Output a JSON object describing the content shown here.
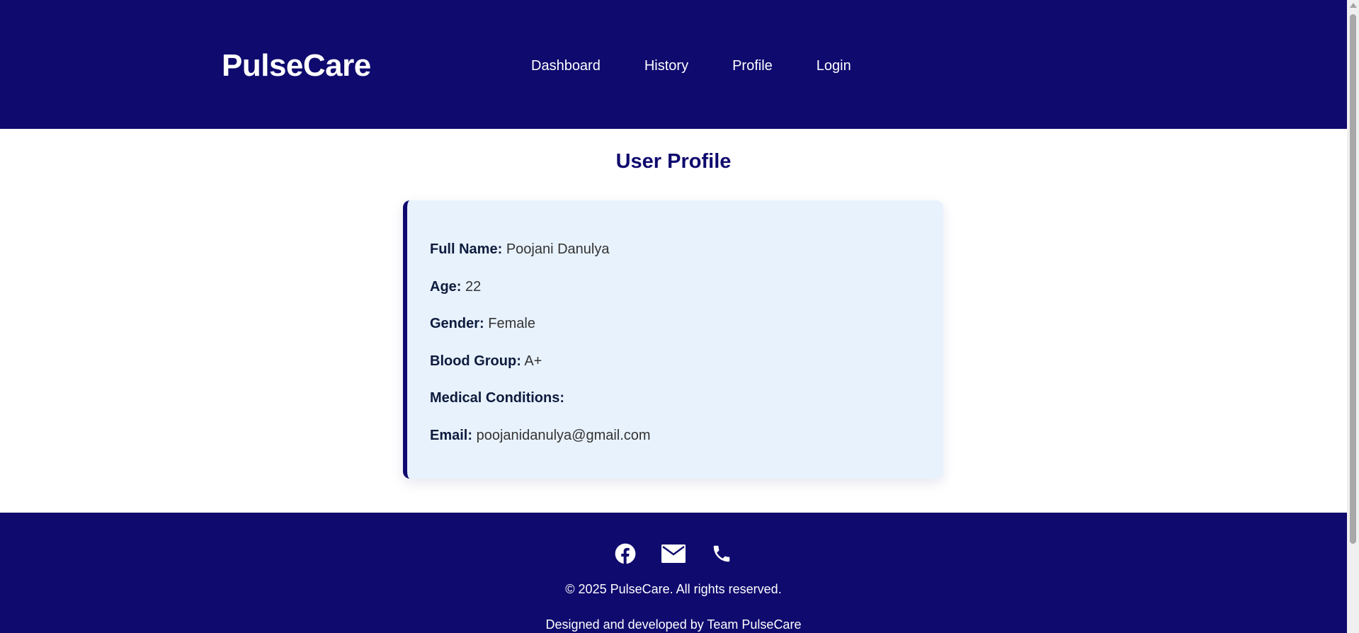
{
  "header": {
    "brand": "PulseCare",
    "nav": [
      {
        "label": "Dashboard"
      },
      {
        "label": "History"
      },
      {
        "label": "Profile"
      },
      {
        "label": "Login"
      }
    ]
  },
  "main": {
    "title": "User Profile",
    "profile": {
      "full_name_label": "Full Name:",
      "full_name": "Poojani Danulya",
      "age_label": "Age:",
      "age": "22",
      "gender_label": "Gender:",
      "gender": "Female",
      "blood_group_label": "Blood Group:",
      "blood_group": "A+",
      "medical_conditions_label": "Medical Conditions:",
      "medical_conditions": "",
      "email_label": "Email:",
      "email": "poojanidanulya@gmail.com"
    }
  },
  "footer": {
    "icons": [
      "facebook-icon",
      "mail-icon",
      "phone-icon"
    ],
    "copyright": "© 2025 PulseCare. All rights reserved.",
    "credit": "Designed and developed by Team PulseCare"
  },
  "colors": {
    "primary": "#0f0a6e",
    "card_bg": "#e8f2fc",
    "label_text": "#0d1b3d",
    "value_text": "#333333"
  }
}
